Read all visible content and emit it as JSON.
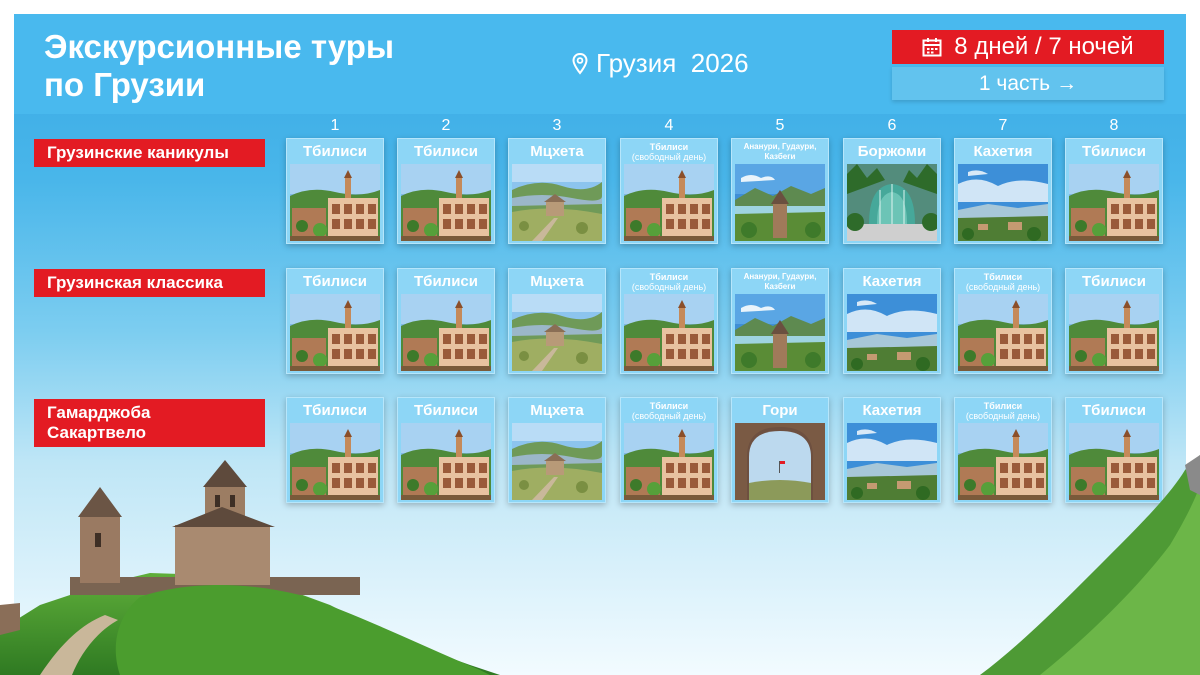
{
  "header": {
    "title_line1": "Экскурсионные туры",
    "title_line2": "по Грузии",
    "location": "Грузия  2026",
    "duration": "8 дней / 7 ночей",
    "part_button": "1 часть",
    "arrow": "→"
  },
  "days": [
    "1",
    "2",
    "3",
    "4",
    "5",
    "6",
    "7",
    "8"
  ],
  "tours": [
    {
      "name_line1": "Грузинские каникулы",
      "name_line2": "",
      "cards": [
        {
          "title": "Тбилиси",
          "sub": "",
          "image": "tbilisi"
        },
        {
          "title": "Тбилиси",
          "sub": "",
          "image": "tbilisi"
        },
        {
          "title": "Мцхета",
          "sub": "",
          "image": "mtskheta"
        },
        {
          "title": "Тбилиси",
          "sub": "(свободный день)",
          "image": "tbilisi"
        },
        {
          "title": "Ананури, Гудаури,",
          "sub": "Казбеги",
          "image": "ananuri"
        },
        {
          "title": "Боржоми",
          "sub": "",
          "image": "borjomi"
        },
        {
          "title": "Кахетия",
          "sub": "",
          "image": "kakheti"
        },
        {
          "title": "Тбилиси",
          "sub": "",
          "image": "tbilisi"
        }
      ]
    },
    {
      "name_line1": "Грузинская классика",
      "name_line2": "",
      "cards": [
        {
          "title": "Тбилиси",
          "sub": "",
          "image": "tbilisi"
        },
        {
          "title": "Тбилиси",
          "sub": "",
          "image": "tbilisi"
        },
        {
          "title": "Мцхета",
          "sub": "",
          "image": "mtskheta"
        },
        {
          "title": "Тбилиси",
          "sub": "(свободный день)",
          "image": "tbilisi"
        },
        {
          "title": "Ананури, Гудаури,",
          "sub": "Казбеги",
          "image": "ananuri"
        },
        {
          "title": "Кахетия",
          "sub": "",
          "image": "kakheti"
        },
        {
          "title": "Тбилиси",
          "sub": "(свободный день)",
          "image": "tbilisi"
        },
        {
          "title": "Тбилиси",
          "sub": "",
          "image": "tbilisi"
        }
      ]
    },
    {
      "name_line1": "Гамарджоба",
      "name_line2": "Сакартвело",
      "cards": [
        {
          "title": "Тбилиси",
          "sub": "",
          "image": "tbilisi"
        },
        {
          "title": "Тбилиси",
          "sub": "",
          "image": "tbilisi"
        },
        {
          "title": "Мцхета",
          "sub": "",
          "image": "mtskheta"
        },
        {
          "title": "Тбилиси",
          "sub": "(свободный день)",
          "image": "tbilisi"
        },
        {
          "title": "Гори",
          "sub": "",
          "image": "gori"
        },
        {
          "title": "Кахетия",
          "sub": "",
          "image": "kakheti"
        },
        {
          "title": "Тбилиси",
          "sub": "(свободный день)",
          "image": "tbilisi"
        },
        {
          "title": "Тбилиси",
          "sub": "",
          "image": "tbilisi"
        }
      ]
    }
  ],
  "colors": {
    "accent_red": "#e31b23",
    "sky_blue": "#49b9ee",
    "card_blue": "#8dd6f6"
  },
  "icons": [
    "location-pin-icon",
    "calendar-icon",
    "arrow-right-icon"
  ]
}
